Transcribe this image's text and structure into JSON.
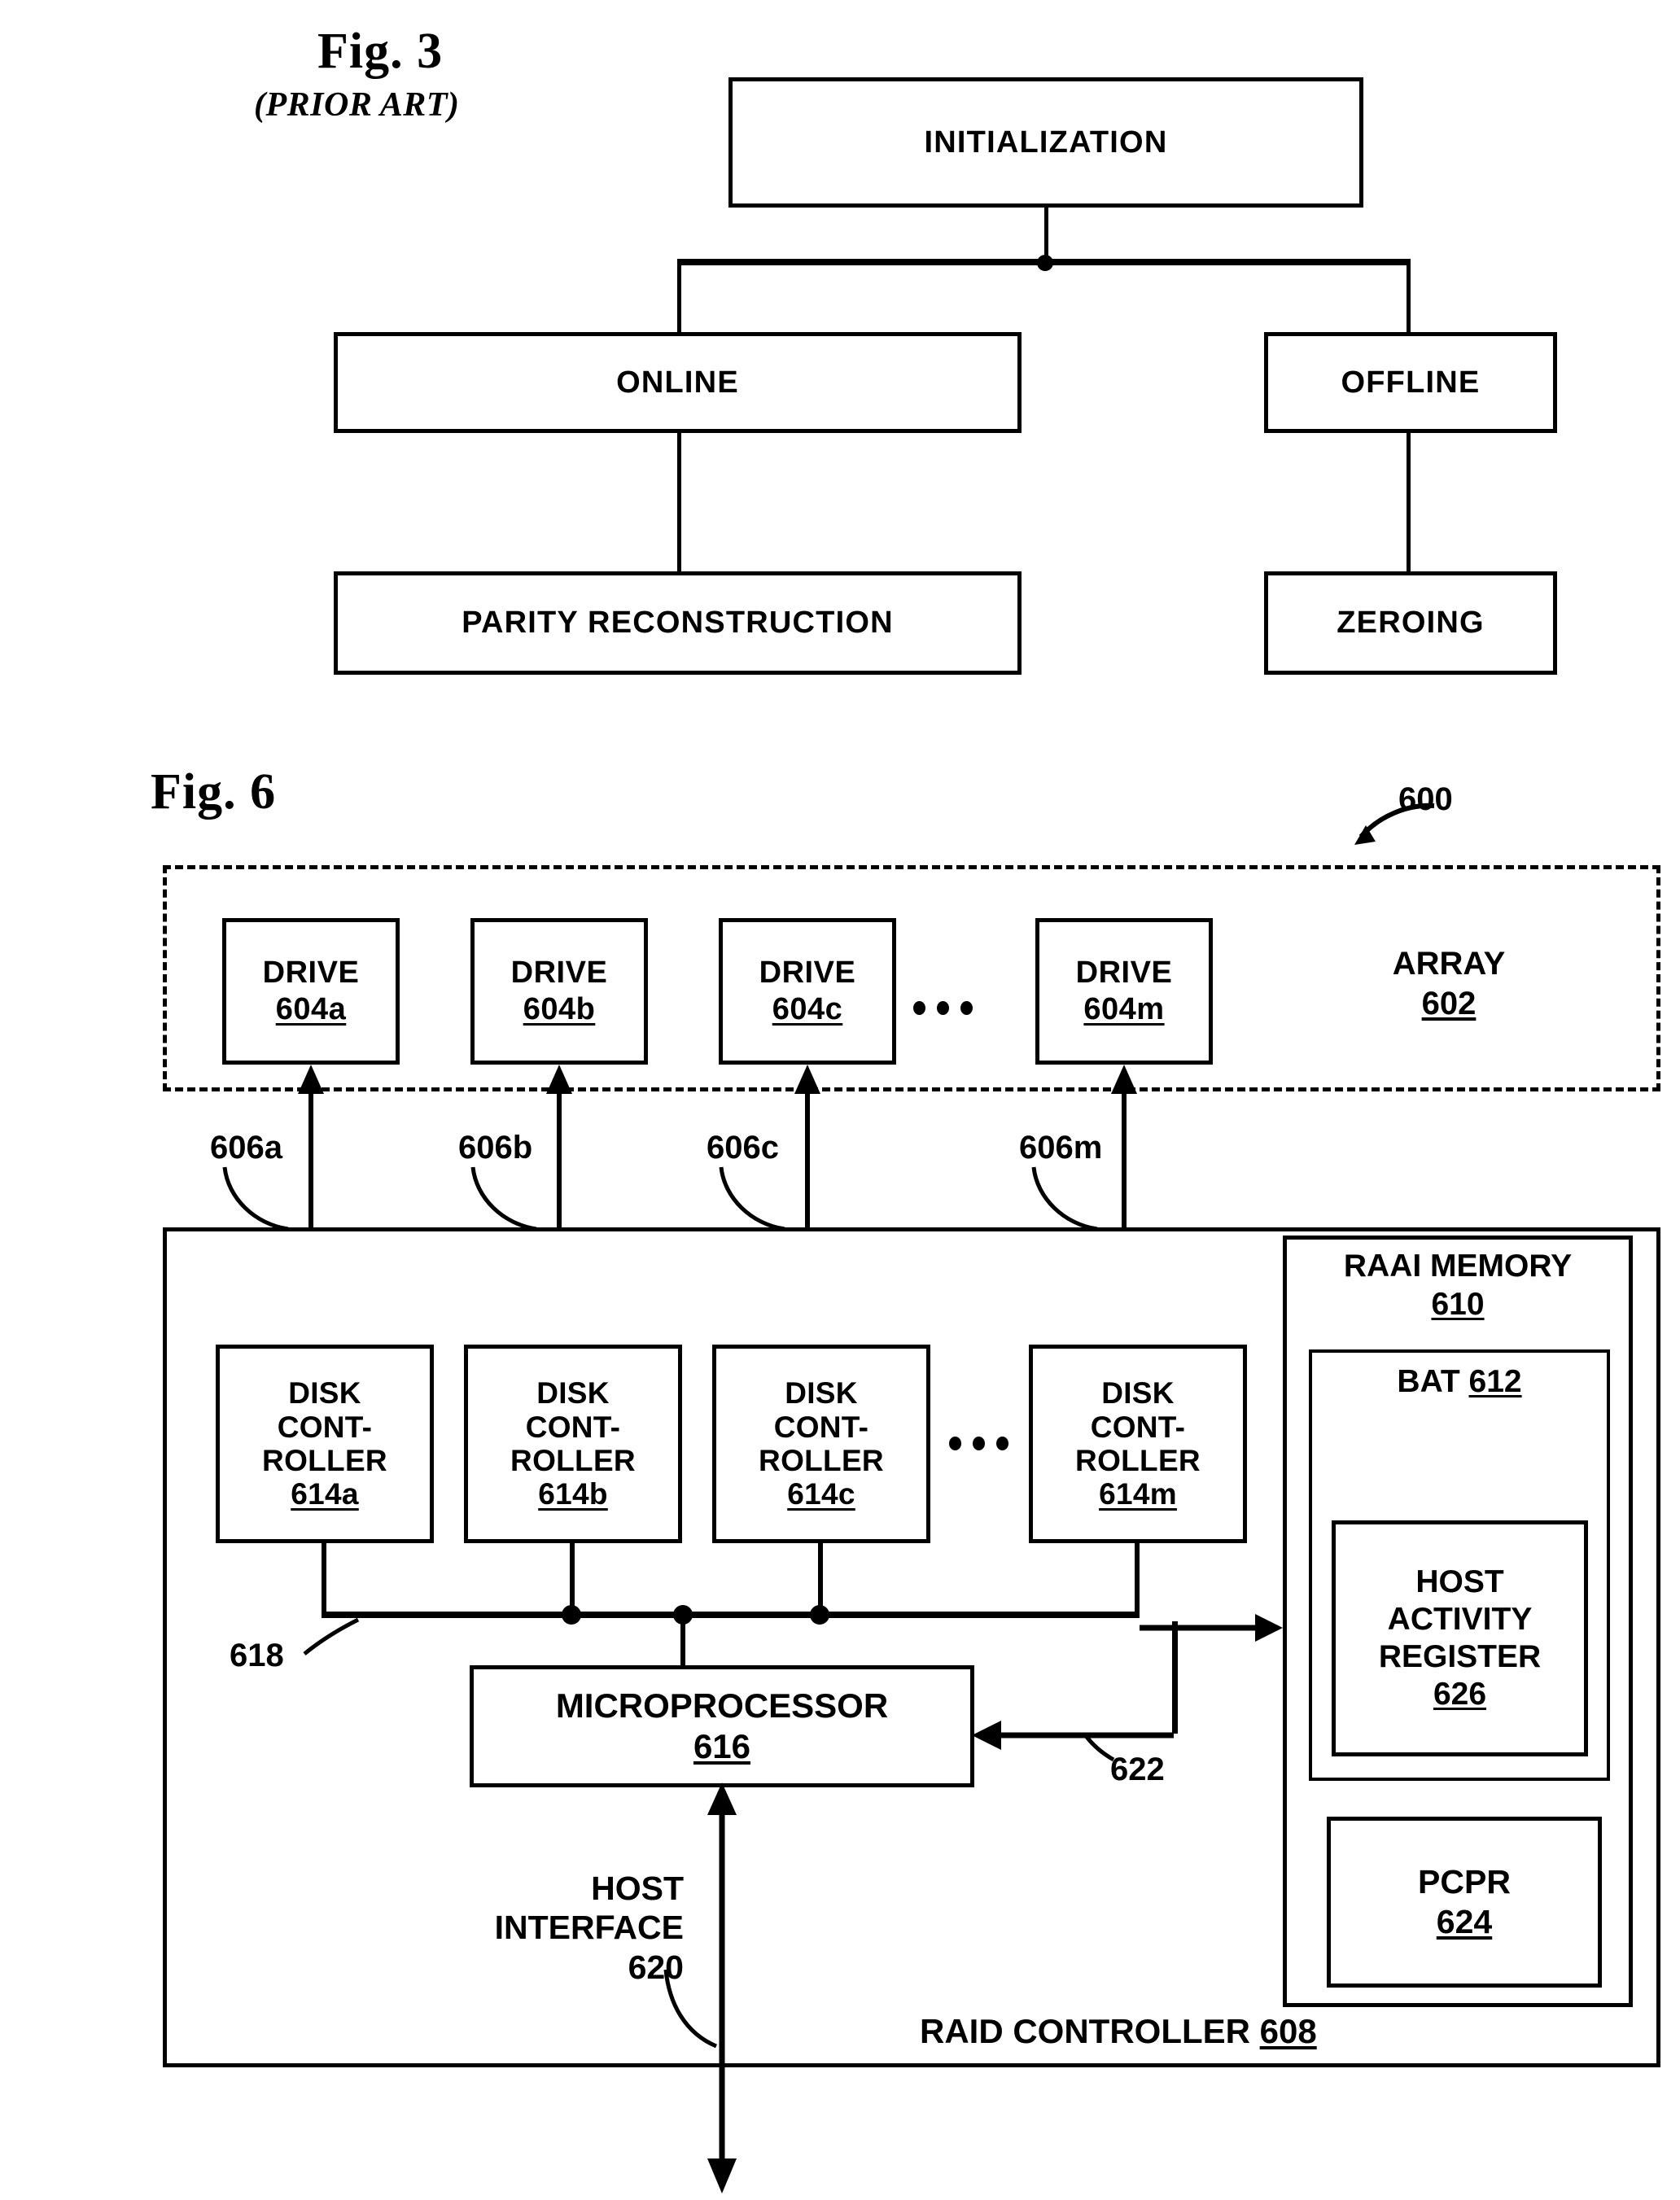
{
  "figures": [
    {
      "id": "fig3",
      "title": "Fig. 3",
      "subtitle": "(PRIOR ART)",
      "type": "flowchart",
      "nodes": [
        {
          "name": "initialization",
          "label": "INITIALIZATION"
        },
        {
          "name": "online",
          "label": "ONLINE"
        },
        {
          "name": "offline",
          "label": "OFFLINE"
        },
        {
          "name": "parity-reconstruction",
          "label": "PARITY RECONSTRUCTION"
        },
        {
          "name": "zeroing",
          "label": "ZEROING"
        }
      ]
    },
    {
      "id": "fig6",
      "title": "Fig. 6",
      "type": "block-diagram",
      "system_ref": "600",
      "array": {
        "label": "ARRAY",
        "ref": "602",
        "drives": [
          {
            "label": "DRIVE",
            "ref": "604a"
          },
          {
            "label": "DRIVE",
            "ref": "604b"
          },
          {
            "label": "DRIVE",
            "ref": "604c"
          },
          {
            "label": "DRIVE",
            "ref": "604m"
          }
        ],
        "ellipsis": "• • •"
      },
      "bus_refs": [
        "606a",
        "606b",
        "606c",
        "606m"
      ],
      "controller": {
        "label": "RAID CONTROLLER",
        "ref": "608",
        "disk_controllers": [
          {
            "line1": "DISK",
            "line2": "CONT-",
            "line3": "ROLLER",
            "ref": "614a"
          },
          {
            "line1": "DISK",
            "line2": "CONT-",
            "line3": "ROLLER",
            "ref": "614b"
          },
          {
            "line1": "DISK",
            "line2": "CONT-",
            "line3": "ROLLER",
            "ref": "614c"
          },
          {
            "line1": "DISK",
            "line2": "CONT-",
            "line3": "ROLLER",
            "ref": "614m"
          }
        ],
        "internal_bus_ref": "618",
        "microprocessor": {
          "label": "MICROPROCESSOR",
          "ref": "616"
        },
        "host_interface": {
          "line1": "HOST",
          "line2": "INTERFACE",
          "ref": "620"
        },
        "feedback_ref": "622",
        "memory": {
          "label_line1": "RAAI MEMORY",
          "ref": "610",
          "bat": {
            "label": "BAT",
            "ref": "612"
          },
          "host_activity_register": {
            "line1": "HOST",
            "line2": "ACTIVITY",
            "line3": "REGISTER",
            "ref": "626"
          },
          "pcpr": {
            "label": "PCPR",
            "ref": "624"
          }
        }
      }
    }
  ],
  "colors": {
    "ink": "#000000",
    "paper": "#ffffff"
  }
}
